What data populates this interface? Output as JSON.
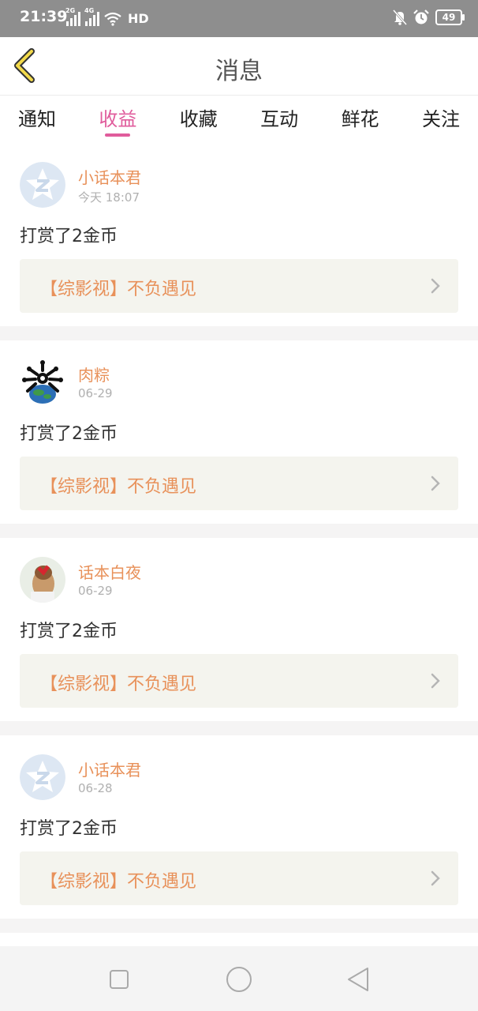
{
  "status_bar": {
    "time": "21:39",
    "net_1": "2G",
    "net_2": "4G",
    "hd": "HD",
    "battery": "49",
    "icons": [
      "signal-icon",
      "signal-icon",
      "wifi-icon",
      "mute-icon",
      "alarm-icon",
      "battery-icon"
    ]
  },
  "header": {
    "title": "消息",
    "back_icon": "chevron-left-icon"
  },
  "tabs": [
    {
      "label": "通知",
      "active": false
    },
    {
      "label": "收益",
      "active": true
    },
    {
      "label": "收藏",
      "active": false
    },
    {
      "label": "互动",
      "active": false
    },
    {
      "label": "鲜花",
      "active": false
    },
    {
      "label": "关注",
      "active": false
    }
  ],
  "messages": [
    {
      "user": "小话本君",
      "time": "今天 18:07",
      "text": "打赏了2金币",
      "link": "【综影视】不负遇见",
      "avatar": "default-avatar-icon"
    },
    {
      "user": "肉粽",
      "time": "06-29",
      "text": "打赏了2金币",
      "link": "【综影视】不负遇见",
      "avatar": "globe-avatar"
    },
    {
      "user": "话本白夜",
      "time": "06-29",
      "text": "打赏了2金币",
      "link": "【综影视】不负遇见",
      "avatar": "photo-avatar"
    },
    {
      "user": "小话本君",
      "time": "06-28",
      "text": "打赏了2金币",
      "link": "【综影视】不负遇见",
      "avatar": "default-avatar-icon"
    }
  ],
  "colors": {
    "accent": "#e05c9c",
    "username": "#e8915a",
    "link_bg": "#f4f4ee",
    "status_bar": "#8e8e8e"
  },
  "nav_bar": {
    "icons": [
      "recent-apps-icon",
      "home-icon",
      "back-icon"
    ]
  }
}
